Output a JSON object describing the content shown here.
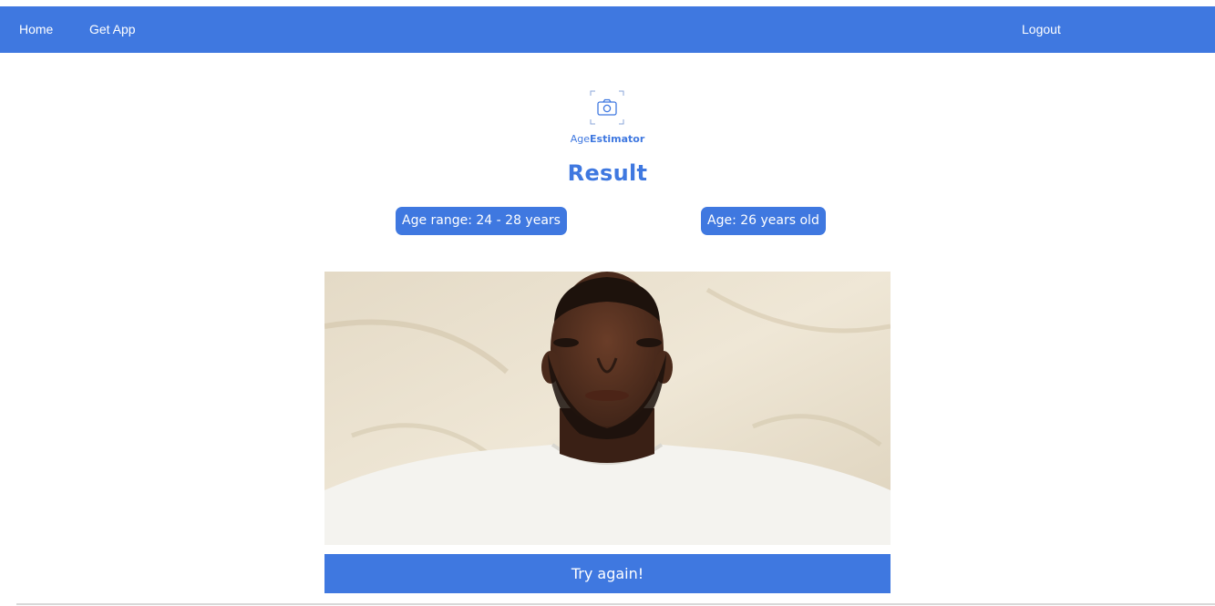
{
  "nav": {
    "home_label": "Home",
    "get_app_label": "Get App",
    "logout_label": "Logout"
  },
  "logo": {
    "prefix": "Age",
    "bold": "Estimator",
    "icon": "camera-icon"
  },
  "result": {
    "title": "Result",
    "age_range": "Age range: 24 - 28 years",
    "age": "Age: 26 years old"
  },
  "photo": {
    "icon": "portrait-photo"
  },
  "actions": {
    "try_again_label": "Try again!"
  },
  "colors": {
    "accent": "#3f78e0",
    "background": "#ffffff"
  }
}
